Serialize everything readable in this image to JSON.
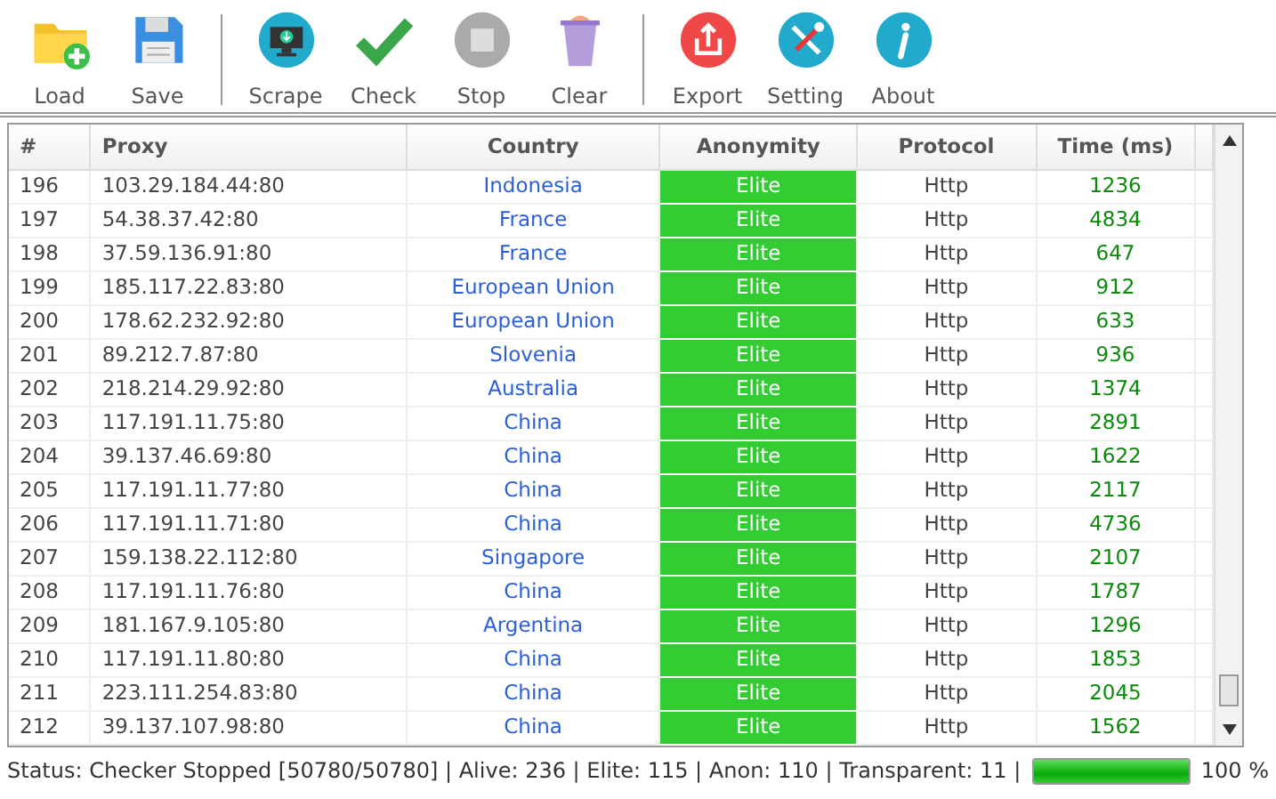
{
  "toolbar": [
    [
      {
        "kind": "load",
        "label": "Load"
      },
      {
        "kind": "save",
        "label": "Save"
      }
    ],
    [
      {
        "kind": "scrape",
        "label": "Scrape"
      },
      {
        "kind": "check",
        "label": "Check"
      },
      {
        "kind": "stop",
        "label": "Stop"
      },
      {
        "kind": "clear",
        "label": "Clear"
      }
    ],
    [
      {
        "kind": "export",
        "label": "Export"
      },
      {
        "kind": "setting",
        "label": "Setting"
      },
      {
        "kind": "about",
        "label": "About"
      }
    ]
  ],
  "table": {
    "columns": [
      "#",
      "Proxy",
      "Country",
      "Anonymity",
      "Protocol",
      "Time (ms)"
    ],
    "rows": [
      [
        "196",
        "103.29.184.44:80",
        "Indonesia",
        "Elite",
        "Http",
        "1236"
      ],
      [
        "197",
        "54.38.37.42:80",
        "France",
        "Elite",
        "Http",
        "4834"
      ],
      [
        "198",
        "37.59.136.91:80",
        "France",
        "Elite",
        "Http",
        "647"
      ],
      [
        "199",
        "185.117.22.83:80",
        "European Union",
        "Elite",
        "Http",
        "912"
      ],
      [
        "200",
        "178.62.232.92:80",
        "European Union",
        "Elite",
        "Http",
        "633"
      ],
      [
        "201",
        "89.212.7.87:80",
        "Slovenia",
        "Elite",
        "Http",
        "936"
      ],
      [
        "202",
        "218.214.29.92:80",
        "Australia",
        "Elite",
        "Http",
        "1374"
      ],
      [
        "203",
        "117.191.11.75:80",
        "China",
        "Elite",
        "Http",
        "2891"
      ],
      [
        "204",
        "39.137.46.69:80",
        "China",
        "Elite",
        "Http",
        "1622"
      ],
      [
        "205",
        "117.191.11.77:80",
        "China",
        "Elite",
        "Http",
        "2117"
      ],
      [
        "206",
        "117.191.11.71:80",
        "China",
        "Elite",
        "Http",
        "4736"
      ],
      [
        "207",
        "159.138.22.112:80",
        "Singapore",
        "Elite",
        "Http",
        "2107"
      ],
      [
        "208",
        "117.191.11.76:80",
        "China",
        "Elite",
        "Http",
        "1787"
      ],
      [
        "209",
        "181.167.9.105:80",
        "Argentina",
        "Elite",
        "Http",
        "1296"
      ],
      [
        "210",
        "117.191.11.80:80",
        "China",
        "Elite",
        "Http",
        "1853"
      ],
      [
        "211",
        "223.111.254.83:80",
        "China",
        "Elite",
        "Http",
        "2045"
      ],
      [
        "212",
        "39.137.107.98:80",
        "China",
        "Elite",
        "Http",
        "1562"
      ]
    ]
  },
  "status_bar": {
    "text": "Status: Checker Stopped [50780/50780] | Alive: 236 | Elite: 115 | Anon: 110 | Transparent: 11 |",
    "progress": {
      "level": 1,
      "reading": "100 %"
    }
  }
}
